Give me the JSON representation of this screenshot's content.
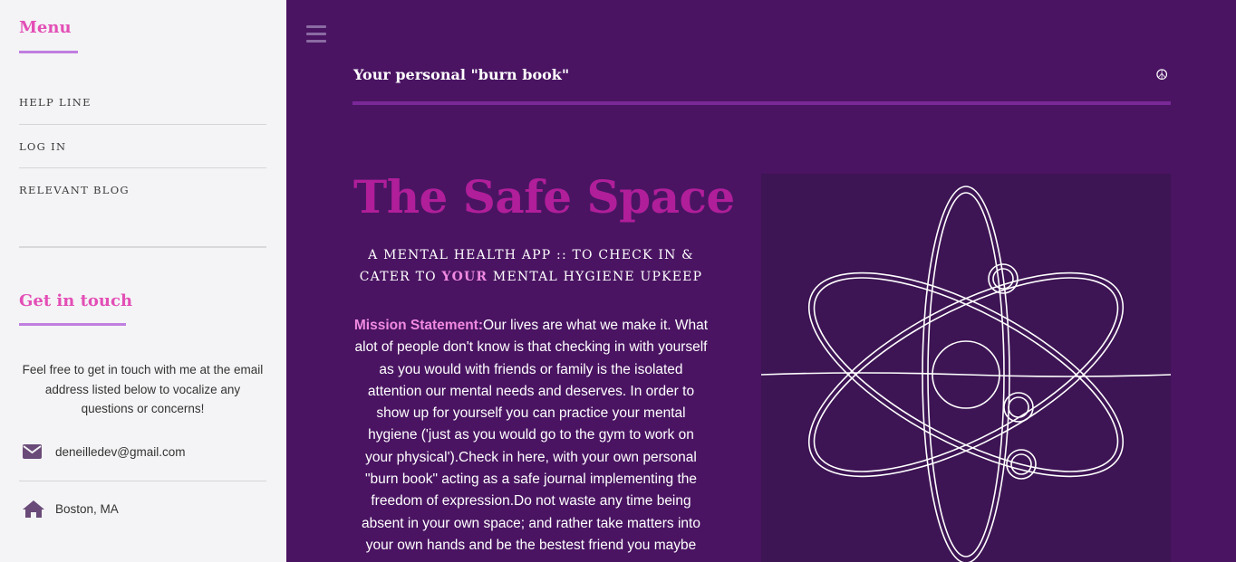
{
  "sidebar": {
    "menu_title": "Menu",
    "nav": [
      {
        "label": "HELP LINE"
      },
      {
        "label": "LOG IN"
      },
      {
        "label": "RELEVANT BLOG"
      }
    ],
    "touch_title": "Get in touch",
    "touch_text": "Feel free to get in touch with me at the email address listed below to vocalize any questions or concerns!",
    "email": "deneilledev@gmail.com",
    "location": "Boston, MA",
    "icons": [
      "envelope-icon",
      "home-icon"
    ]
  },
  "header": {
    "title": "Your personal \"burn book\"",
    "peace_symbol": "☮"
  },
  "hero": {
    "title": "The Safe Space",
    "subtitle_part1": "A MENTAL HEALTH APP :: TO CHECK IN & CATER TO ",
    "subtitle_accent": "YOUR",
    "subtitle_part2": " MENTAL HYGIENE UPKEEP",
    "mission_label": "Mission Statement:",
    "mission_text": "Our lives are what we make it. What alot of people don't know is that checking in with yourself as you would with friends or family is the isolated attention our mental needs and deserves. In order to show up for yourself you can practice your mental hygiene ('just as you would go to the gym to work on your physical').Check in here, with your own personal \"burn book\" acting as a safe journal implementing the freedom of expression.Do not waste any time being absent in your own space; and rather take matters into your own hands and be the bestest friend you maybe"
  },
  "colors": {
    "main_bg": "#4a1462",
    "sidebar_bg": "#f4f4f6",
    "accent_pink": "#e34fb6",
    "hero_title": "#b01e9a",
    "rule": "#7a2898",
    "mission_label": "#f08ae0"
  }
}
